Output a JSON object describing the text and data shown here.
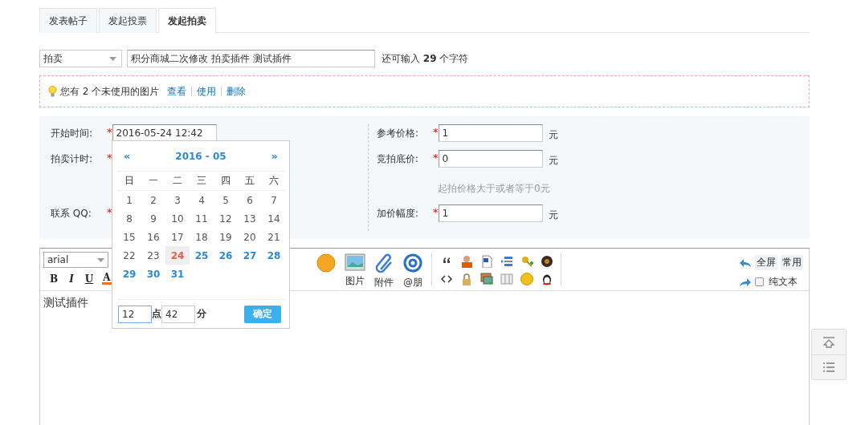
{
  "tabs": [
    {
      "label": "发表帖子",
      "selected": false
    },
    {
      "label": "发起投票",
      "selected": false
    },
    {
      "label": "发起拍卖",
      "selected": true
    }
  ],
  "title_row": {
    "category": "拍卖",
    "title": "积分商城二次修改 拍卖插件 测试插件",
    "counter": "还可输入 **29** 个字符"
  },
  "notice": {
    "text": "您有 2 个未使用的图片",
    "links": [
      "查看",
      "使用",
      "删除"
    ]
  },
  "form": {
    "left": [
      {
        "label": "开始时间:",
        "required_mark": "*",
        "value": "2016-05-24 12:42"
      },
      {
        "label": "拍卖计时:",
        "required_mark": "*"
      },
      {
        "label": "联系 QQ:",
        "required_mark": "*"
      }
    ],
    "right": [
      {
        "label": "参考价格:",
        "required_mark": "*",
        "value": "1",
        "unit": "元"
      },
      {
        "label": "竞拍底价:",
        "required_mark": "*",
        "value": "0",
        "unit": "元",
        "hint": "起拍价格大于或者等于0元"
      },
      {
        "label": "加价幅度:",
        "required_mark": "*",
        "value": "1",
        "unit": "元"
      }
    ]
  },
  "calendar": {
    "prev": "«",
    "title": "2016 - 05",
    "next": "»",
    "weekdays": [
      "日",
      "一",
      "二",
      "三",
      "四",
      "五",
      "六"
    ],
    "days": [
      {
        "label": "1",
        "kind": "past"
      },
      {
        "label": "2",
        "kind": "past"
      },
      {
        "label": "3",
        "kind": "past"
      },
      {
        "label": "4",
        "kind": "past"
      },
      {
        "label": "5",
        "kind": "past"
      },
      {
        "label": "6",
        "kind": "past"
      },
      {
        "label": "7",
        "kind": "past"
      },
      {
        "label": "8",
        "kind": "past"
      },
      {
        "label": "9",
        "kind": "past"
      },
      {
        "label": "10",
        "kind": "past"
      },
      {
        "label": "11",
        "kind": "past"
      },
      {
        "label": "12",
        "kind": "past"
      },
      {
        "label": "13",
        "kind": "past"
      },
      {
        "label": "14",
        "kind": "past"
      },
      {
        "label": "15",
        "kind": "past"
      },
      {
        "label": "16",
        "kind": "past"
      },
      {
        "label": "17",
        "kind": "past"
      },
      {
        "label": "18",
        "kind": "past"
      },
      {
        "label": "19",
        "kind": "past"
      },
      {
        "label": "20",
        "kind": "past"
      },
      {
        "label": "21",
        "kind": "past"
      },
      {
        "label": "22",
        "kind": "past"
      },
      {
        "label": "23",
        "kind": "past"
      },
      {
        "label": "24",
        "kind": "today"
      },
      {
        "label": "25",
        "kind": "future"
      },
      {
        "label": "26",
        "kind": "future"
      },
      {
        "label": "27",
        "kind": "future"
      },
      {
        "label": "28",
        "kind": "future"
      },
      {
        "label": "29",
        "kind": "future"
      },
      {
        "label": "30",
        "kind": "future"
      },
      {
        "label": "31",
        "kind": "future"
      }
    ],
    "hour": "12",
    "hour_unit": "点",
    "minute": "42",
    "minute_unit": "分",
    "confirm": "确定"
  },
  "editor": {
    "font": "arial",
    "format_buttons": [
      "B",
      "I",
      "U",
      "A"
    ],
    "tools": [
      {
        "kind": "emoticon"
      },
      {
        "kind": "image",
        "label": "图片"
      },
      {
        "kind": "attachment",
        "label": "附件"
      },
      {
        "kind": "mention",
        "label": "@朋"
      }
    ],
    "fullscreen": "全屏",
    "common": "常用",
    "plain_text": {
      "label": "纯文本",
      "checked": false
    },
    "content": "测试插件"
  }
}
